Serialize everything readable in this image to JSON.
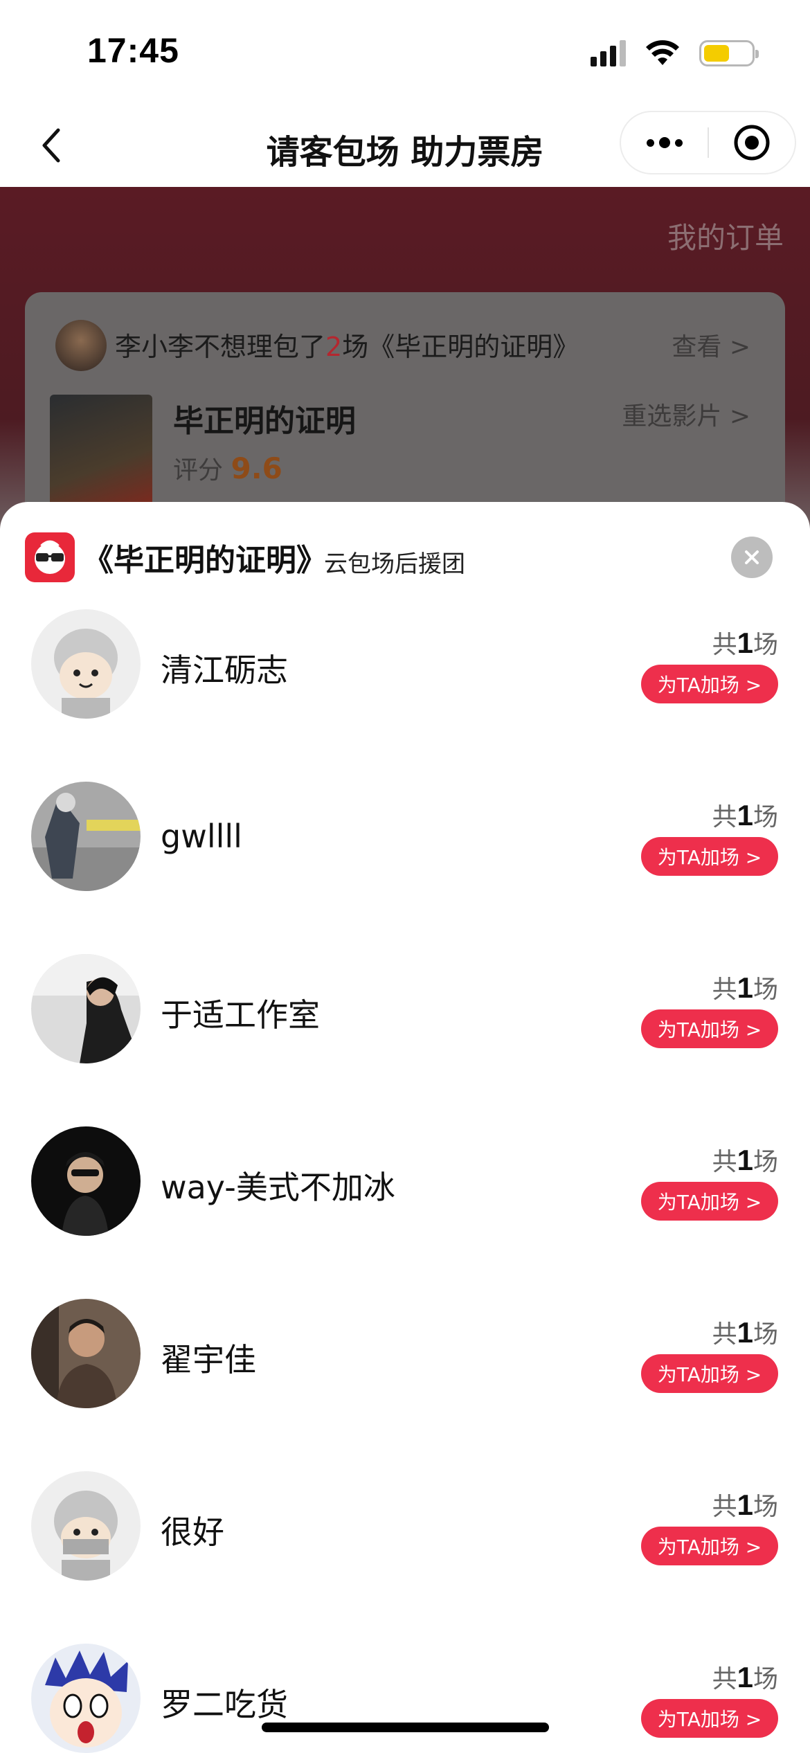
{
  "status_bar": {
    "time": "17:45"
  },
  "nav": {
    "title": "请客包场 助力票房"
  },
  "background": {
    "my_orders": "我的订单",
    "banner_prefix": "李小李不想理包了",
    "banner_count": "2",
    "banner_suffix": "场《毕正明的证明》",
    "view_link": "查看 >",
    "film_name": "毕正明的证明",
    "score_label": "评分",
    "score_value": "9.6",
    "reselect": "重选影片 >"
  },
  "sheet": {
    "title": "《毕正明的证明》",
    "subtitle": "云包场后援团",
    "members": [
      {
        "name": "清江砺志",
        "count_prefix": "共",
        "count": "1",
        "count_suffix": "场",
        "button": "为TA加场 >"
      },
      {
        "name": "gwllll",
        "count_prefix": "共",
        "count": "1",
        "count_suffix": "场",
        "button": "为TA加场 >"
      },
      {
        "name": "于适工作室",
        "count_prefix": "共",
        "count": "1",
        "count_suffix": "场",
        "button": "为TA加场 >"
      },
      {
        "name": "way-美式不加冰",
        "count_prefix": "共",
        "count": "1",
        "count_suffix": "场",
        "button": "为TA加场 >"
      },
      {
        "name": "翟宇佳",
        "count_prefix": "共",
        "count": "1",
        "count_suffix": "场",
        "button": "为TA加场 >"
      },
      {
        "name": "很好",
        "count_prefix": "共",
        "count": "1",
        "count_suffix": "场",
        "button": "为TA加场 >"
      },
      {
        "name": "罗二吃货",
        "count_prefix": "共",
        "count": "1",
        "count_suffix": "场",
        "button": "为TA加场 >"
      }
    ]
  },
  "colors": {
    "accent": "#ee2f4c",
    "header_bg": "#5a1b24"
  }
}
